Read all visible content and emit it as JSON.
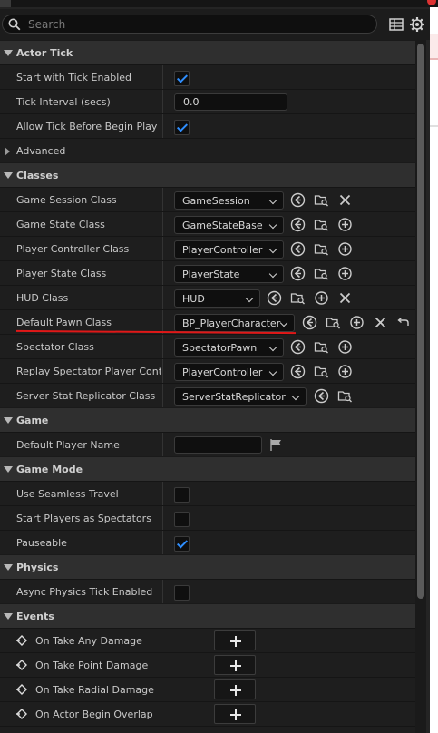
{
  "search": {
    "placeholder": "Search"
  },
  "toolbar": {
    "view_icon": "table-view-icon",
    "settings_icon": "gear-icon"
  },
  "sections": {
    "actor_tick": {
      "title": "Actor Tick",
      "start_with_tick": {
        "label": "Start with Tick Enabled",
        "checked": true
      },
      "tick_interval": {
        "label": "Tick Interval (secs)",
        "value": "0.0"
      },
      "allow_tick": {
        "label": "Allow Tick Before Begin Play",
        "checked": true
      },
      "advanced": "Advanced"
    },
    "classes": {
      "title": "Classes",
      "rows": [
        {
          "label": "Game Session Class",
          "value": "GameSession"
        },
        {
          "label": "Game State Class",
          "value": "GameStateBase"
        },
        {
          "label": "Player Controller Class",
          "value": "PlayerController"
        },
        {
          "label": "Player State Class",
          "value": "PlayerState"
        },
        {
          "label": "HUD Class",
          "value": "HUD"
        },
        {
          "label": "Default Pawn Class",
          "value": "BP_PlayerCharacter"
        },
        {
          "label": "Spectator Class",
          "value": "SpectatorPawn"
        },
        {
          "label": "Replay Spectator Player Contr...",
          "value": "PlayerController"
        },
        {
          "label": "Server Stat Replicator Class",
          "value": "ServerStatReplicator"
        }
      ]
    },
    "game": {
      "title": "Game",
      "default_player_name": {
        "label": "Default Player Name",
        "value": ""
      }
    },
    "game_mode": {
      "title": "Game Mode",
      "use_seamless": {
        "label": "Use Seamless Travel",
        "checked": false
      },
      "start_spectators": {
        "label": "Start Players as Spectators",
        "checked": false
      },
      "pauseable": {
        "label": "Pauseable",
        "checked": true
      }
    },
    "physics": {
      "title": "Physics",
      "async_tick": {
        "label": "Async Physics Tick Enabled",
        "checked": false
      }
    },
    "events": {
      "title": "Events",
      "rows": [
        {
          "label": "On Take Any Damage"
        },
        {
          "label": "On Take Point Damage"
        },
        {
          "label": "On Take Radial Damage"
        },
        {
          "label": "On Actor Begin Overlap"
        }
      ]
    }
  },
  "colors": {
    "accent_check": "#2f8fff",
    "annotation": "#e01818"
  }
}
